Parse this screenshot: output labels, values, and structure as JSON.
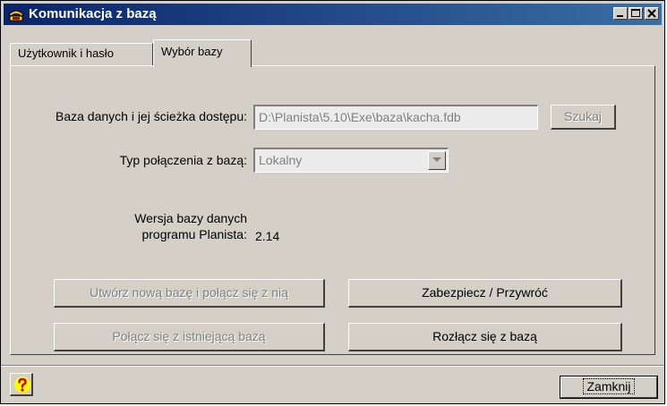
{
  "window": {
    "title": "Komunikacja z bazą"
  },
  "caption_buttons": [
    {
      "name": "minimize",
      "icon": "minimize-icon"
    },
    {
      "name": "maximize",
      "icon": "maximize-icon"
    },
    {
      "name": "close",
      "icon": "close-icon"
    }
  ],
  "tabs": [
    {
      "label": "Użytkownik i hasło",
      "active": false
    },
    {
      "label": "Wybór bazy",
      "active": true
    }
  ],
  "database": {
    "path_label": "Baza danych i jej ścieżka dostępu:",
    "path_value": "D:\\Planista\\5.10\\Exe\\baza\\kacha.fdb",
    "browse_label": "Szukaj",
    "connection_type_label": "Typ połączenia z bazą:",
    "connection_type_value": "Lokalny",
    "version_label_line1": "Wersja bazy danych",
    "version_label_line2": "programu Planista:",
    "version_value": "2.14"
  },
  "actions": {
    "create_connect": "Utwórz nową bazę i połącz się z nią",
    "backup_restore": "Zabezpiecz / Przywróć",
    "connect_existing": "Połącz się z istniejącą bazą",
    "disconnect": "Rozłącz się z bazą"
  },
  "footer": {
    "help_icon": "question-icon",
    "close_label": "Zamknij"
  },
  "colors": {
    "face": "#d4d0c8",
    "title_start": "#0a246a",
    "title_end": "#3a6ea5",
    "disabled_text": "#808080",
    "help_yellow": "#ffff00"
  }
}
